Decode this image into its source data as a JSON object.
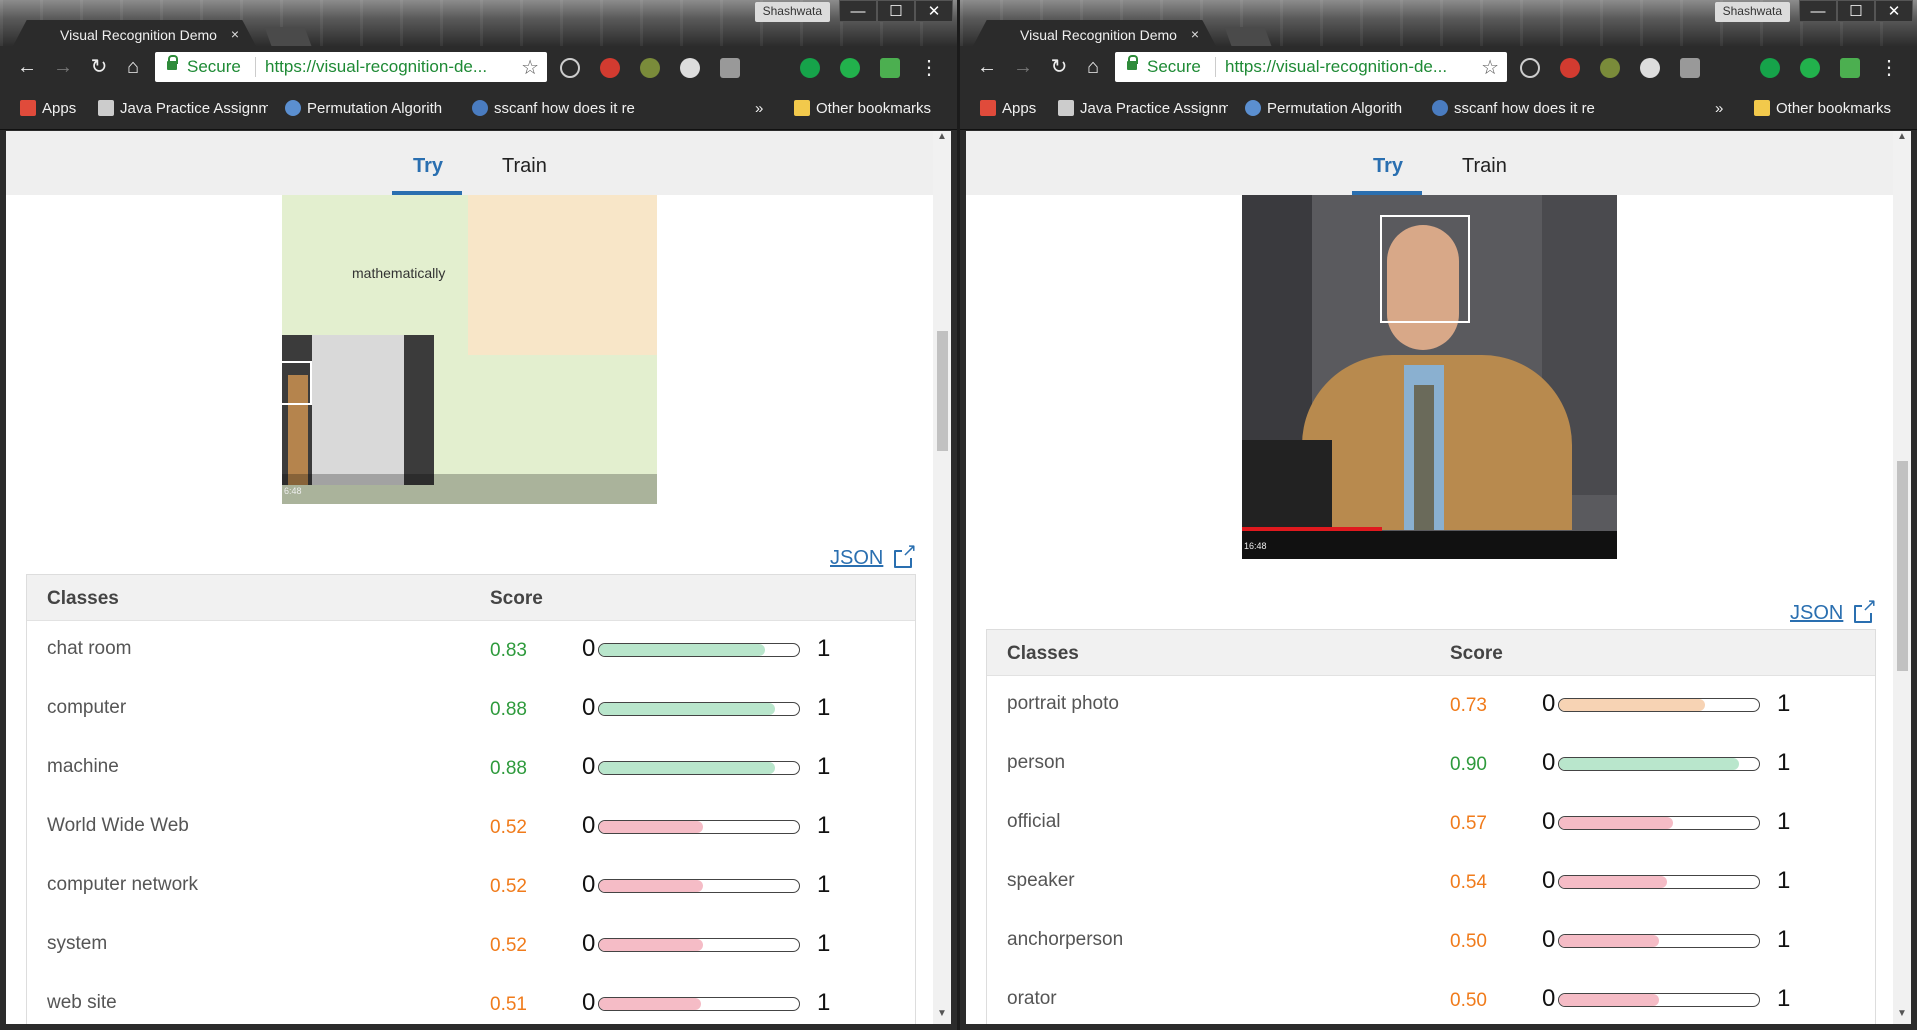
{
  "browser": {
    "tab_title": "Visual Recognition Demo",
    "tab_close": "×",
    "profile": "Shashwata",
    "secure_label": "Secure",
    "url": "https://visual-recognition-de...",
    "window_controls": [
      "—",
      "☐",
      "✕"
    ],
    "bookmarks": [
      {
        "label": "Apps",
        "icon": "apps-grid-icon",
        "color": "#e04b3b"
      },
      {
        "label": "Java Practice Assignm",
        "icon": "java-icon",
        "color": "#cccccc"
      },
      {
        "label": "Permutation Algorith",
        "icon": "globe-icon",
        "color": "#5b8fd0"
      },
      {
        "label": "sscanf how does it re",
        "icon": "globe-icon",
        "color": "#4a7cc0"
      }
    ],
    "overflow": "»",
    "other_bookmarks": "Other bookmarks"
  },
  "page": {
    "tabs": [
      {
        "label": "Try",
        "active": true
      },
      {
        "label": "Train",
        "active": false
      }
    ],
    "json_link": "JSON",
    "table_headers": {
      "classes": "Classes",
      "score": "Score"
    },
    "scale_min": "0",
    "scale_max": "1"
  },
  "left": {
    "timestamp": "6:48",
    "image_text": "mathematically",
    "results": [
      {
        "class": "chat room",
        "score": "0.83",
        "value": 0.83,
        "level": "hi"
      },
      {
        "class": "computer",
        "score": "0.88",
        "value": 0.88,
        "level": "hi"
      },
      {
        "class": "machine",
        "score": "0.88",
        "value": 0.88,
        "level": "hi"
      },
      {
        "class": "World Wide Web",
        "score": "0.52",
        "value": 0.52,
        "level": "mid"
      },
      {
        "class": "computer network",
        "score": "0.52",
        "value": 0.52,
        "level": "mid"
      },
      {
        "class": "system",
        "score": "0.52",
        "value": 0.52,
        "level": "mid"
      },
      {
        "class": "web site",
        "score": "0.51",
        "value": 0.51,
        "level": "mid"
      }
    ]
  },
  "right": {
    "timestamp": "16:48",
    "results": [
      {
        "class": "portrait photo",
        "score": "0.73",
        "value": 0.73,
        "level": "orange"
      },
      {
        "class": "person",
        "score": "0.90",
        "value": 0.9,
        "level": "hi"
      },
      {
        "class": "official",
        "score": "0.57",
        "value": 0.57,
        "level": "mid"
      },
      {
        "class": "speaker",
        "score": "0.54",
        "value": 0.54,
        "level": "mid"
      },
      {
        "class": "anchorperson",
        "score": "0.50",
        "value": 0.5,
        "level": "mid"
      },
      {
        "class": "orator",
        "score": "0.50",
        "value": 0.5,
        "level": "mid"
      }
    ]
  },
  "colors": {
    "accent": "#2a6fb0",
    "score_high": "#2e9a3c",
    "score_mid": "#f07b1b"
  }
}
